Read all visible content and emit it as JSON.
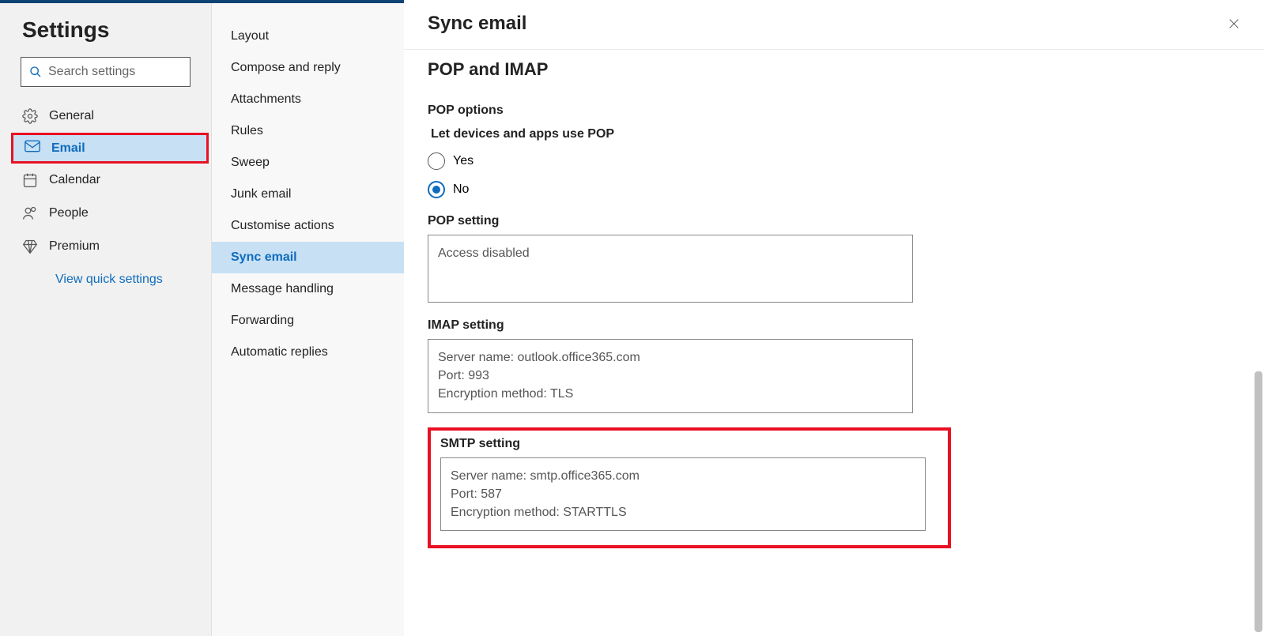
{
  "sidebar": {
    "title": "Settings",
    "search_placeholder": "Search settings",
    "items": [
      {
        "label": "General"
      },
      {
        "label": "Email"
      },
      {
        "label": "Calendar"
      },
      {
        "label": "People"
      },
      {
        "label": "Premium"
      }
    ],
    "link": "View quick settings"
  },
  "subnav": {
    "items": [
      "Layout",
      "Compose and reply",
      "Attachments",
      "Rules",
      "Sweep",
      "Junk email",
      "Customise actions",
      "Sync email",
      "Message handling",
      "Forwarding",
      "Automatic replies"
    ]
  },
  "panel": {
    "title": "Sync email",
    "section_title": "POP and IMAP",
    "pop_options_title": "POP options",
    "pop_allow_label": "Let devices and apps use POP",
    "radio_yes": "Yes",
    "radio_no": "No",
    "pop_setting_label": "POP setting",
    "pop_setting_value": "Access disabled",
    "imap_label": "IMAP setting",
    "imap": {
      "server": "Server name: outlook.office365.com",
      "port": "Port: 993",
      "enc": "Encryption method: TLS"
    },
    "smtp_label": "SMTP setting",
    "smtp": {
      "server": "Server name: smtp.office365.com",
      "port": "Port: 587",
      "enc": "Encryption method: STARTTLS"
    }
  }
}
